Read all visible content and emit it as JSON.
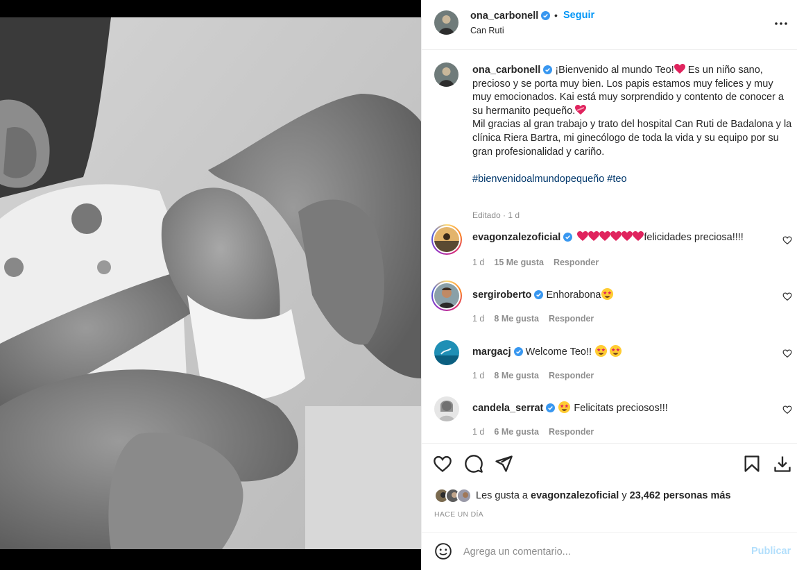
{
  "post": {
    "username": "ona_carbonell",
    "dot": "•",
    "follow_label": "Seguir",
    "location": "Can Ruti",
    "caption": {
      "username": "ona_carbonell",
      "line1": "¡Bienvenido al mundo Teo!",
      "line1b": " Es un niño sano, precioso y se porta muy bien. Los papis estamos muy felices y muy muy emocionados. Kai está muy sorprendido y contento de conocer a su hermanito pequeño.",
      "line2": "Mil gracias al gran trabajo y trato del hospital Can Ruti de Badalona y la clínica Riera Bartra, mi ginecólogo de toda la vida y su equipo por su gran profesionalidad y cariño.",
      "hashtags": "#bienvenidoalmundopequeño #teo",
      "meta": "Editado · 1 d"
    }
  },
  "comments": [
    {
      "username": "evagonzalezoficial",
      "text": "felicidades preciosa!!!!",
      "time": "1 d",
      "likes": "15 Me gusta",
      "reply": "Responder",
      "hearts": 6,
      "avatar_color": "#8a6a3a"
    },
    {
      "username": "sergiroberto",
      "text": "Enhorabona",
      "time": "1 d",
      "likes": "8 Me gusta",
      "reply": "Responder",
      "avatar_color": "#b07a55"
    },
    {
      "username": "margacj",
      "text": "Welcome Teo!! ",
      "time": "1 d",
      "likes": "8 Me gusta",
      "reply": "Responder",
      "avatar_color": "#1f8fb5"
    },
    {
      "username": "candela_serrat",
      "text": " Felicitats preciosos!!!",
      "time": "1 d",
      "likes": "6 Me gusta",
      "reply": "Responder",
      "avatar_color": "#d9d9d9"
    }
  ],
  "likes": {
    "prefix": "Les gusta a ",
    "user": "evagonzalezoficial",
    "middle": " y ",
    "count": "23,462 personas más"
  },
  "post_time": "HACE UN DÍA",
  "comment_box": {
    "placeholder": "Agrega un comentario...",
    "publish_label": "Publicar"
  },
  "colors": {
    "accent": "#0095f6",
    "verified": "#3897f0",
    "heart": "#e0245e",
    "hashtag": "#00376b",
    "muted": "#8e8e8e"
  }
}
